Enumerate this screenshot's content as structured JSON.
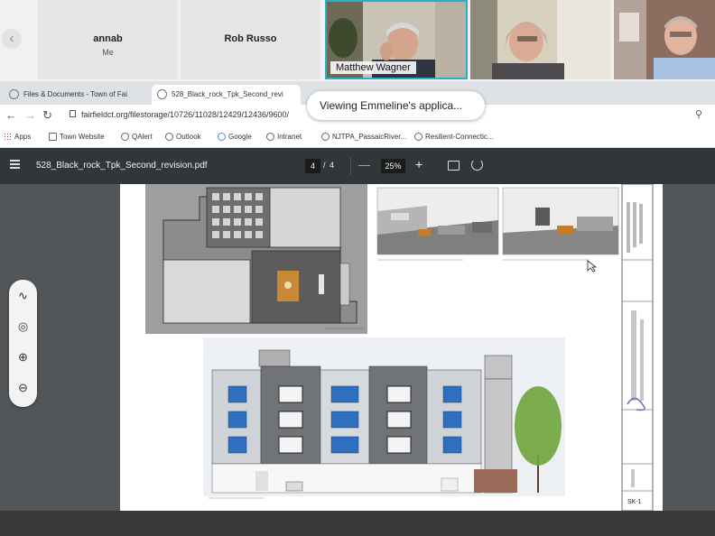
{
  "meeting": {
    "tiles": [
      {
        "name": "annab",
        "subtitle": "Me"
      },
      {
        "name": "Rob Russo",
        "subtitle": ""
      }
    ],
    "active_speaker_caption": "Matthew Wagner"
  },
  "browser": {
    "tabs": [
      {
        "label": "Files & Documents - Town of Fai",
        "active": false
      },
      {
        "label": "528_Black_rock_Tpk_Second_revi",
        "active": true
      }
    ],
    "share_toast": "Viewing Emmeline's applica...",
    "url": "fairfieldct.org/filestorage/10726/11028/12429/12436/9600/",
    "bookmarks": [
      "Apps",
      "Town Website",
      "QAlert",
      "Outlook",
      "Google",
      "Intranet",
      "NJTPA_PassaicRiver...",
      "Resilient-Connectic..."
    ]
  },
  "pdf": {
    "filename": "528_Black_rock_Tpk_Second_revision.pdf",
    "current_page": "4",
    "page_separator": "/",
    "total_pages": "4",
    "zoom": "25%",
    "sheet_number": "SK-1",
    "icons": [
      "menu-icon",
      "zoom-out-icon",
      "zoom-in-icon",
      "fit-page-icon",
      "rotate-icon"
    ]
  },
  "palette": {
    "icons": [
      "pen-icon",
      "touch-icon",
      "zoom-in-icon",
      "zoom-out-icon"
    ]
  },
  "colors": {
    "toolbar": "#323639",
    "viewer_bg": "#525659",
    "active_tile_border": "#27b0c9",
    "window_blue": "#2f6fc0"
  }
}
